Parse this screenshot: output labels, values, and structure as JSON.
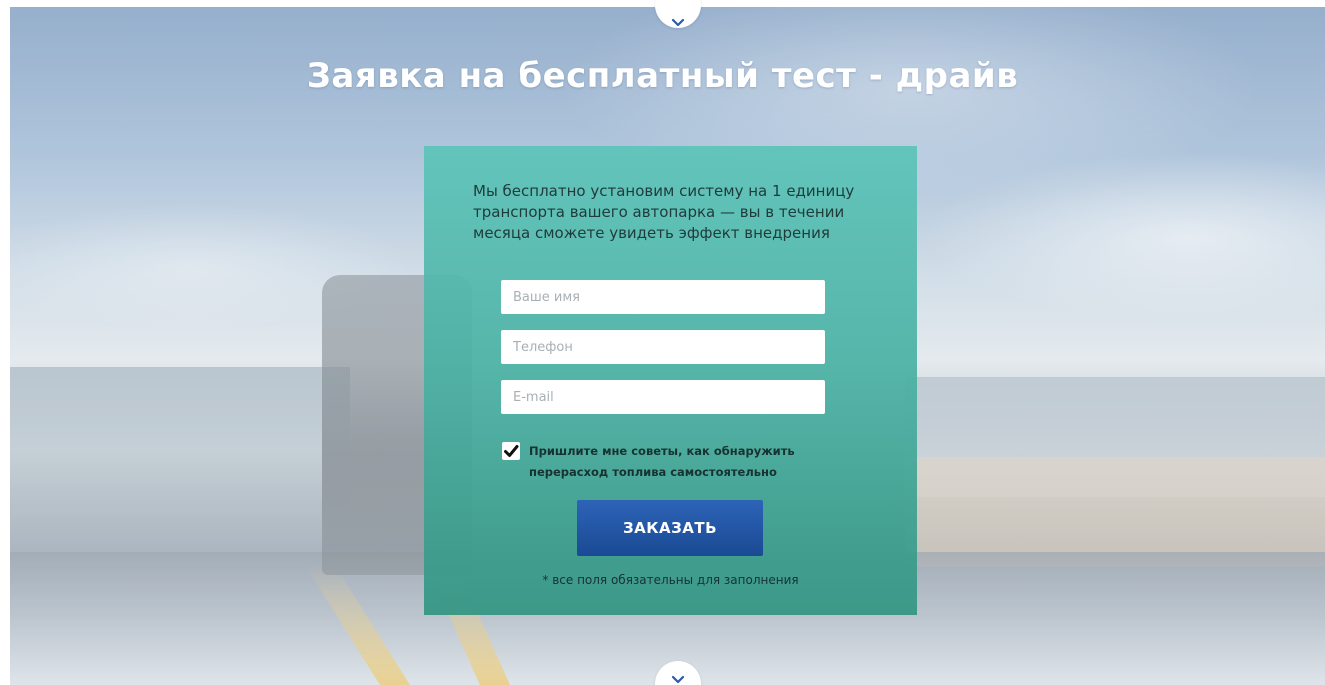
{
  "header": {
    "title": "Заявка на бесплатный тест - драйв"
  },
  "form": {
    "intro": "Мы бесплатно установим систему на 1 единицу транспорта вашего автопарка — вы в течении месяца сможете увидеть эффект внедрения",
    "name_placeholder": "Ваше имя",
    "name_value": "",
    "phone_placeholder": "Телефон",
    "phone_value": "",
    "email_placeholder": "E-mail",
    "email_value": "",
    "consent_checked": true,
    "consent_label": "Пришлите мне советы, как обнаружить перерасход топлива самостоятельно",
    "submit_label": "ЗАКАЗАТЬ",
    "required_note": "* все поля обязательны для заполнения"
  },
  "icons": {
    "scroll_up": "chevron-down-icon",
    "scroll_down": "chevron-down-icon",
    "checkbox": "checkmark-icon"
  },
  "colors": {
    "panel": "#4fb5a5",
    "button": "#1f54a3",
    "title": "#ffffff"
  }
}
